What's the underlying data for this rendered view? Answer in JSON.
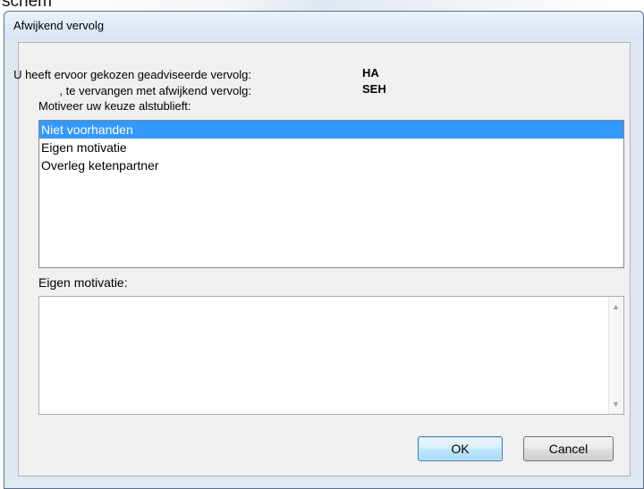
{
  "background": {
    "partial_text": "schem"
  },
  "window": {
    "title": "Afwijkend vervolg"
  },
  "form": {
    "advised_label": "U heeft ervoor gekozen geadviseerde vervolg:",
    "advised_value": "HA",
    "replace_label": ", te vervangen met afwijkend vervolg:",
    "replace_value": "SEH",
    "motivate_label": "Motiveer uw keuze alstublieft:",
    "own_motivation_label": "Eigen motivatie:",
    "own_motivation_value": ""
  },
  "reasons": [
    {
      "label": "Niet voorhanden",
      "selected": true
    },
    {
      "label": "Eigen motivatie",
      "selected": false
    },
    {
      "label": "Overleg ketenpartner",
      "selected": false
    }
  ],
  "buttons": {
    "ok": "OK",
    "cancel": "Cancel"
  },
  "icons": {
    "scroll_up": "scroll-up-arrow-icon",
    "scroll_down": "scroll-down-arrow-icon"
  },
  "colors": {
    "selection": "#3399ff",
    "dialog_frame": "#dfe7f1"
  }
}
